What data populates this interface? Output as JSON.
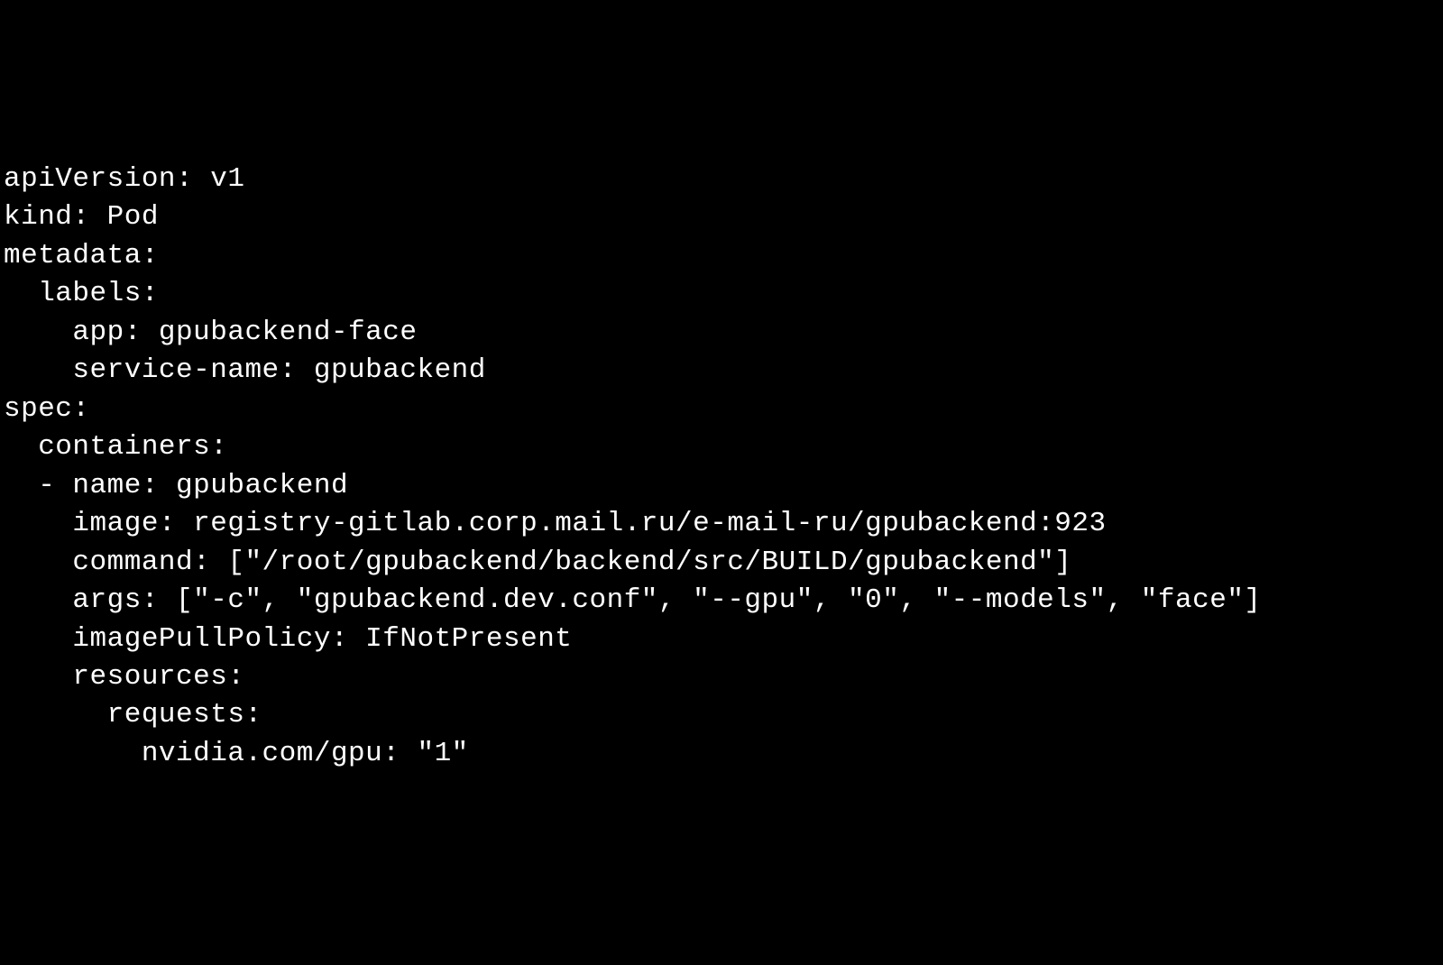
{
  "code": {
    "line1": "apiVersion: v1",
    "line2": "kind: Pod",
    "line3": "metadata:",
    "line4": "  labels:",
    "line5": "    app: gpubackend-face",
    "line6": "    service-name: gpubackend",
    "line7": "spec:",
    "line8": "  containers:",
    "line9": "  - name: gpubackend",
    "line10": "    image: registry-gitlab.corp.mail.ru/e-mail-ru/gpubackend:923",
    "line11": "    command: [\"/root/gpubackend/backend/src/BUILD/gpubackend\"]",
    "line12": "    args: [\"-c\", \"gpubackend.dev.conf\", \"--gpu\", \"0\", \"--models\", \"face\"]",
    "line13": "    imagePullPolicy: IfNotPresent",
    "line14": "    resources:",
    "line15": "      requests:",
    "line16": "        nvidia.com/gpu: \"1\""
  }
}
